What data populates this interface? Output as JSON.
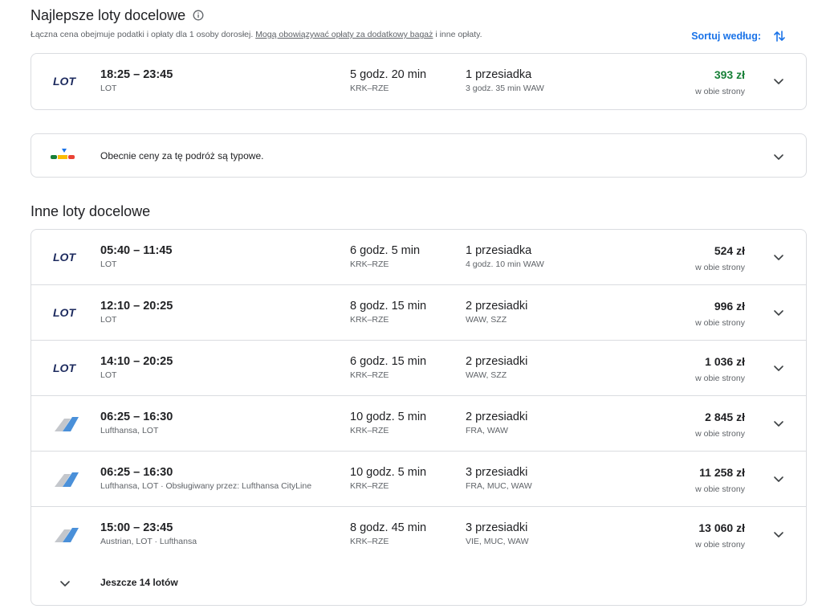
{
  "best": {
    "title": "Najlepsze loty docelowe",
    "note_prefix": "Łączna cena obejmuje podatki i opłaty dla 1 osoby dorosłej. ",
    "note_link": "Mogą obowiązywać opłaty za dodatkowy bagaż",
    "note_suffix": " i inne opłaty.",
    "sort_label": "Sortuj według:",
    "flights": [
      {
        "airline_logo": "lot-logo",
        "time": "18:25 – 23:45",
        "airline": "LOT",
        "duration": "5 godz. 20 min",
        "route": "KRK–RZE",
        "stops": "1 przesiadka",
        "stops_detail": "3 godz. 35 min WAW",
        "price": "393 zł",
        "price_note": "w obie strony",
        "price_color": "#188038"
      }
    ]
  },
  "price_insight": {
    "text": "Obecnie ceny za tę podróż są typowe."
  },
  "other": {
    "title": "Inne loty docelowe",
    "flights": [
      {
        "airline_logo": "lot-logo",
        "time": "05:40 – 11:45",
        "airline": "LOT",
        "duration": "6 godz. 5 min",
        "route": "KRK–RZE",
        "stops": "1 przesiadka",
        "stops_detail": "4 godz. 10 min WAW",
        "price": "524 zł",
        "price_note": "w obie strony"
      },
      {
        "airline_logo": "lot-logo",
        "time": "12:10 – 20:25",
        "airline": "LOT",
        "duration": "8 godz. 15 min",
        "route": "KRK–RZE",
        "stops": "2 przesiadki",
        "stops_detail": "WAW, SZZ",
        "price": "996 zł",
        "price_note": "w obie strony"
      },
      {
        "airline_logo": "lot-logo",
        "time": "14:10 – 20:25",
        "airline": "LOT",
        "duration": "6 godz. 15 min",
        "route": "KRK–RZE",
        "stops": "2 przesiadki",
        "stops_detail": "WAW, SZZ",
        "price": "1 036 zł",
        "price_note": "w obie strony"
      },
      {
        "airline_logo": "multi-airline-logo",
        "time": "06:25 – 16:30",
        "airline": "Lufthansa, LOT",
        "duration": "10 godz. 5 min",
        "route": "KRK–RZE",
        "stops": "2 przesiadki",
        "stops_detail": "FRA, WAW",
        "price": "2 845 zł",
        "price_note": "w obie strony"
      },
      {
        "airline_logo": "multi-airline-logo",
        "time": "06:25 – 16:30",
        "airline": "Lufthansa, LOT · Obsługiwany przez: Lufthansa CityLine",
        "duration": "10 godz. 5 min",
        "route": "KRK–RZE",
        "stops": "3 przesiadki",
        "stops_detail": "FRA, MUC, WAW",
        "price": "11 258 zł",
        "price_note": "w obie strony"
      },
      {
        "airline_logo": "multi-airline-logo",
        "time": "15:00 – 23:45",
        "airline": "Austrian, LOT · Lufthansa",
        "duration": "8 godz. 45 min",
        "route": "KRK–RZE",
        "stops": "3 przesiadki",
        "stops_detail": "VIE, MUC, WAW",
        "price": "13 060 zł",
        "price_note": "w obie strony"
      }
    ],
    "more_label": "Jeszcze 14 lotów"
  },
  "colors": {
    "accent": "#1a73e8",
    "best_price": "#188038",
    "border": "#dadce0"
  }
}
